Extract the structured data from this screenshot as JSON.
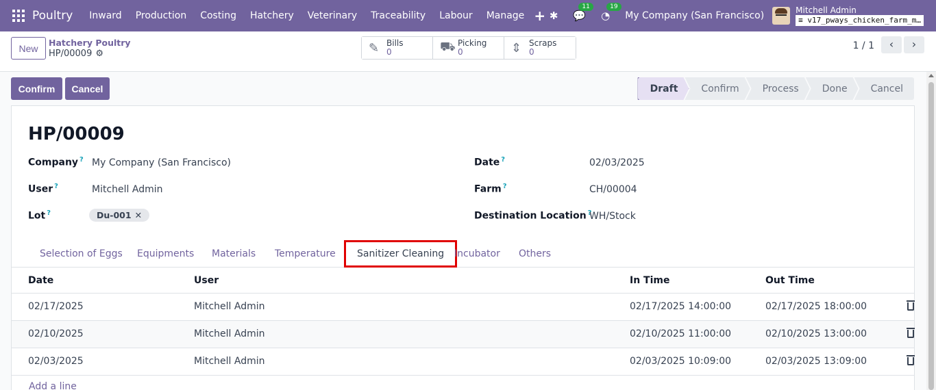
{
  "navbar": {
    "brand": "Poultry",
    "menu": [
      "Inward",
      "Production",
      "Costing",
      "Hatchery",
      "Veterinary",
      "Traceability",
      "Labour",
      "Manage"
    ],
    "messages_count": "11",
    "activities_count": "19",
    "company": "My Company (San Francisco)",
    "user_name": "Mitchell Admin",
    "db_name": "v17_pways_chicken_farm_m…"
  },
  "control": {
    "new_label": "New",
    "breadcrumb_parent": "Hatchery Poultry",
    "breadcrumb_current": "HP/00009",
    "smart_buttons": [
      {
        "label": "Bills",
        "value": "0",
        "icon": "edit-icon"
      },
      {
        "label": "Picking",
        "value": "0",
        "icon": "truck-icon"
      },
      {
        "label": "Scraps",
        "value": "0",
        "icon": "arrows-updown-icon"
      }
    ],
    "pager": "1 / 1"
  },
  "actions": {
    "confirm_label": "Confirm",
    "cancel_label": "Cancel"
  },
  "status": [
    "Draft",
    "Confirm",
    "Process",
    "Done",
    "Cancel"
  ],
  "status_active": "Draft",
  "form": {
    "title": "HP/00009",
    "company_label": "Company",
    "company": "My Company (San Francisco)",
    "user_label": "User",
    "user": "Mitchell Admin",
    "lot_label": "Lot",
    "lot_tag": "Du-001",
    "date_label": "Date",
    "date": "02/03/2025",
    "farm_label": "Farm",
    "farm": "CH/00004",
    "dest_label": "Destination Location",
    "dest": "WH/Stock",
    "help_mark": "?"
  },
  "tabs": [
    "Selection of Eggs",
    "Equipments",
    "Materials",
    "Temperature",
    "Sanitizer Cleaning",
    "Incubator",
    "Others"
  ],
  "active_tab": "Sanitizer Cleaning",
  "table": {
    "headers": [
      "Date",
      "User",
      "In Time",
      "Out Time"
    ],
    "rows": [
      [
        "02/17/2025",
        "Mitchell Admin",
        "02/17/2025 14:00:00",
        "02/17/2025 18:00:00"
      ],
      [
        "02/10/2025",
        "Mitchell Admin",
        "02/10/2025 11:00:00",
        "02/10/2025 13:00:00"
      ],
      [
        "02/03/2025",
        "Mitchell Admin",
        "02/03/2025 10:09:00",
        "02/03/2025 13:09:00"
      ]
    ],
    "add_line": "Add a line"
  }
}
